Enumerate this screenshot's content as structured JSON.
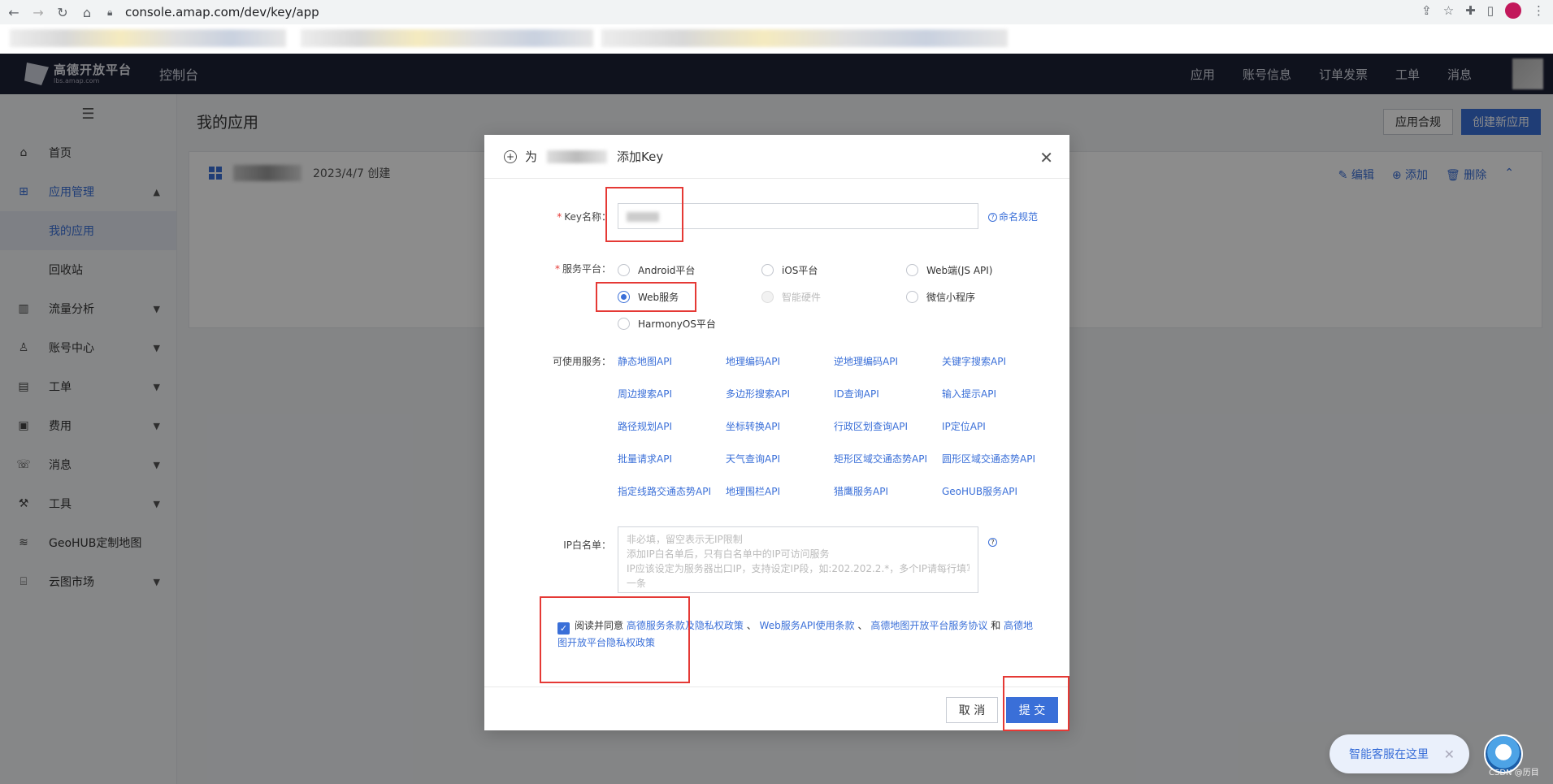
{
  "browser": {
    "url": "console.amap.com/dev/key/app"
  },
  "header": {
    "logo_cn": "高德开放平台",
    "logo_en": "lbs.amap.com",
    "console": "控制台",
    "nav": [
      "应用",
      "账号信息",
      "订单发票",
      "工单",
      "消息"
    ]
  },
  "sidebar": {
    "items": [
      {
        "label": "首页",
        "icon": "home-icon"
      },
      {
        "label": "应用管理",
        "icon": "grid-icon"
      },
      {
        "label": "我的应用"
      },
      {
        "label": "回收站"
      },
      {
        "label": "流量分析",
        "icon": "chart-icon"
      },
      {
        "label": "账号中心",
        "icon": "user-icon"
      },
      {
        "label": "工单",
        "icon": "ticket-icon"
      },
      {
        "label": "费用",
        "icon": "billing-icon"
      },
      {
        "label": "消息",
        "icon": "message-icon"
      },
      {
        "label": "工具",
        "icon": "wrench-icon"
      },
      {
        "label": "GeoHUB定制地图",
        "icon": "layers-icon"
      },
      {
        "label": "云图市场",
        "icon": "store-icon"
      }
    ]
  },
  "main": {
    "title": "我的应用",
    "compliance_btn": "应用合规",
    "create_btn": "创建新应用",
    "card": {
      "created": "2023/4/7 创建",
      "edit": "编辑",
      "add": "添加",
      "delete": "删除"
    }
  },
  "modal": {
    "title_prefix": "为",
    "title_suffix": "添加Key",
    "key_name_label": "Key名称：",
    "naming_link": "命名规范",
    "platform_label": "服务平台：",
    "platforms": [
      {
        "label": "Android平台",
        "state": "unchecked"
      },
      {
        "label": "iOS平台",
        "state": "unchecked"
      },
      {
        "label": "Web端(JS API)",
        "state": "unchecked"
      },
      {
        "label": "Web服务",
        "state": "checked"
      },
      {
        "label": "智能硬件",
        "state": "disabled"
      },
      {
        "label": "微信小程序",
        "state": "unchecked"
      },
      {
        "label": "HarmonyOS平台",
        "state": "unchecked"
      }
    ],
    "services_label": "可使用服务：",
    "services": [
      "静态地图API",
      "地理编码API",
      "逆地理编码API",
      "关键字搜索API",
      "周边搜索API",
      "多边形搜索API",
      "ID查询API",
      "输入提示API",
      "路径规划API",
      "坐标转换API",
      "行政区划查询API",
      "IP定位API",
      "批量请求API",
      "天气查询API",
      "矩形区域交通态势API",
      "圆形区域交通态势API",
      "指定线路交通态势API",
      "地理围栏API",
      "猎鹰服务API",
      "GeoHUB服务API"
    ],
    "ip_label": "IP白名单：",
    "ip_placeholder_lines": [
      "非必填，留空表示无IP限制",
      "添加IP白名单后，只有白名单中的IP可访问服务",
      "IP应该设定为服务器出口IP，支持设定IP段，如:202.202.2.*，多个IP请每行填写",
      "一条"
    ],
    "agree": {
      "prefix": "阅读并同意",
      "link1": "高德服务条款及隐私权政策",
      "sep1": "、",
      "link2": "Web服务API使用条款",
      "sep2": "、",
      "link3": "高德地图开放平台服务协议",
      "and": "和",
      "link4": "高德地图开放平台隐私权政策"
    },
    "cancel": "取 消",
    "submit": "提 交"
  },
  "chat": {
    "label": "智能客服在这里"
  },
  "watermark": "CSDN @历目",
  "colors": {
    "primary": "#3a6fd8",
    "header_bg": "#1d2136",
    "highlight": "#e53935"
  }
}
